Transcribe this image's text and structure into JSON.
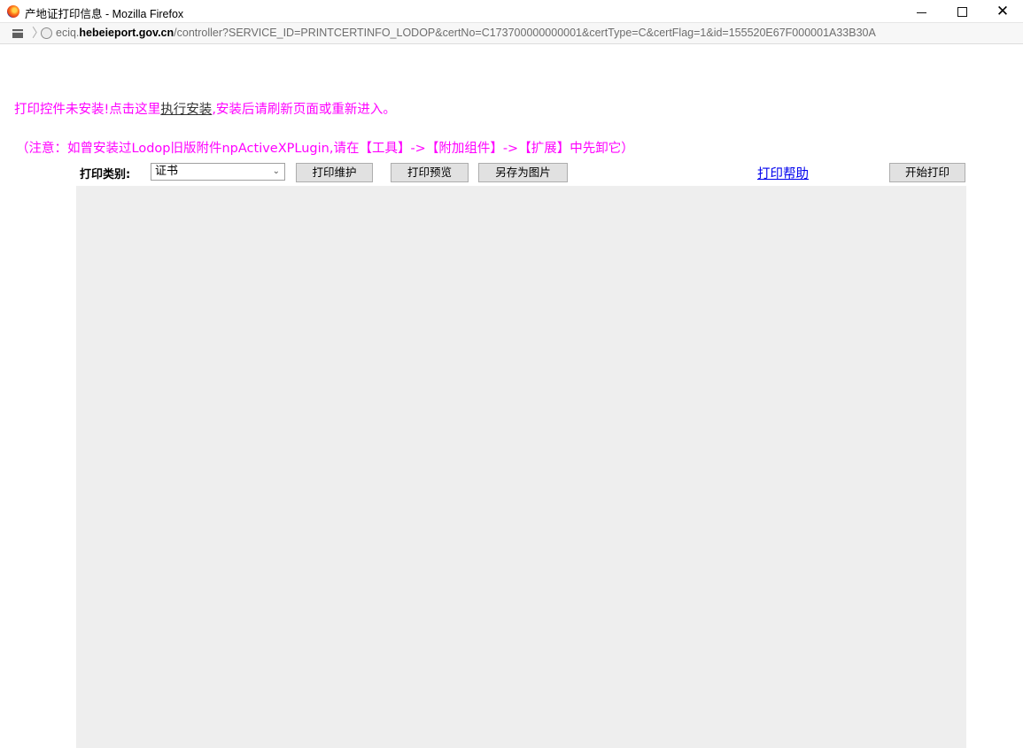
{
  "window": {
    "title": "产地证打印信息 - Mozilla Firefox",
    "minimize_glyph": "",
    "close_glyph": "✕"
  },
  "addressbar": {
    "url_prefix": "eciq.",
    "url_domain": "hebeieport.gov.cn",
    "url_path": "/controller?SERVICE_ID=PRINTCERTINFO_LODOP&certNo=C173700000000001&certType=C&certFlag=1&id=155520E67F000001A33B30A"
  },
  "notice": {
    "line1_before": "打印控件未安装!点击这里",
    "install_link": "执行安装",
    "line1_after": ",安装后请刷新页面或重新进入。",
    "line2": "（注意：如曾安装过Lodop旧版附件npActiveXPLugin,请在【工具】->【附加组件】->【扩展】中先卸它）"
  },
  "toolbar": {
    "print_type_label": "打印类别:",
    "print_type_value": "证书",
    "maintain_button": "打印维护",
    "preview_button": "打印预览",
    "save_image_button": "另存为图片",
    "help_link": "打印帮助",
    "start_button": "开始打印"
  },
  "colors": {
    "notice": "#ff00ff",
    "link": "#0000ee",
    "preview_bg": "#eeeeee"
  },
  "icons": [
    "firefox-icon",
    "minimize-icon",
    "maximize-icon",
    "close-icon",
    "page-icon",
    "globe-icon",
    "chevron-down-icon"
  ]
}
